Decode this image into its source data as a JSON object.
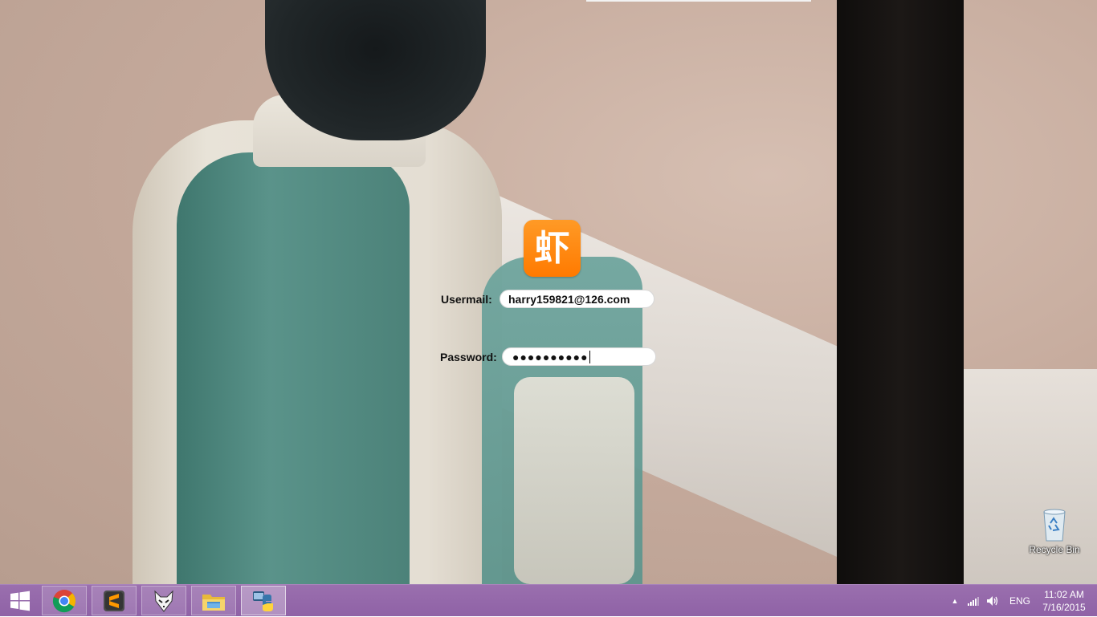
{
  "login": {
    "logo_glyph": "虾",
    "usermail_label": "Usermail:",
    "usermail_value": "harry159821@126.com",
    "password_label": "Password:",
    "password_value": "●●●●●●●●●●"
  },
  "desktop": {
    "recycle_bin_label": "Recycle Bin"
  },
  "taskbar": {
    "apps": [
      {
        "icon": "chrome-icon"
      },
      {
        "icon": "sublime-text-icon"
      },
      {
        "icon": "foobar-player-icon"
      },
      {
        "icon": "file-explorer-icon"
      },
      {
        "icon": "python-icon",
        "active": true
      }
    ],
    "tray": {
      "language": "ENG",
      "time": "11:02 AM",
      "date": "7/16/2015"
    }
  },
  "colors": {
    "taskbar": "#9a6fae",
    "logo_orange": "#ff7a00"
  }
}
